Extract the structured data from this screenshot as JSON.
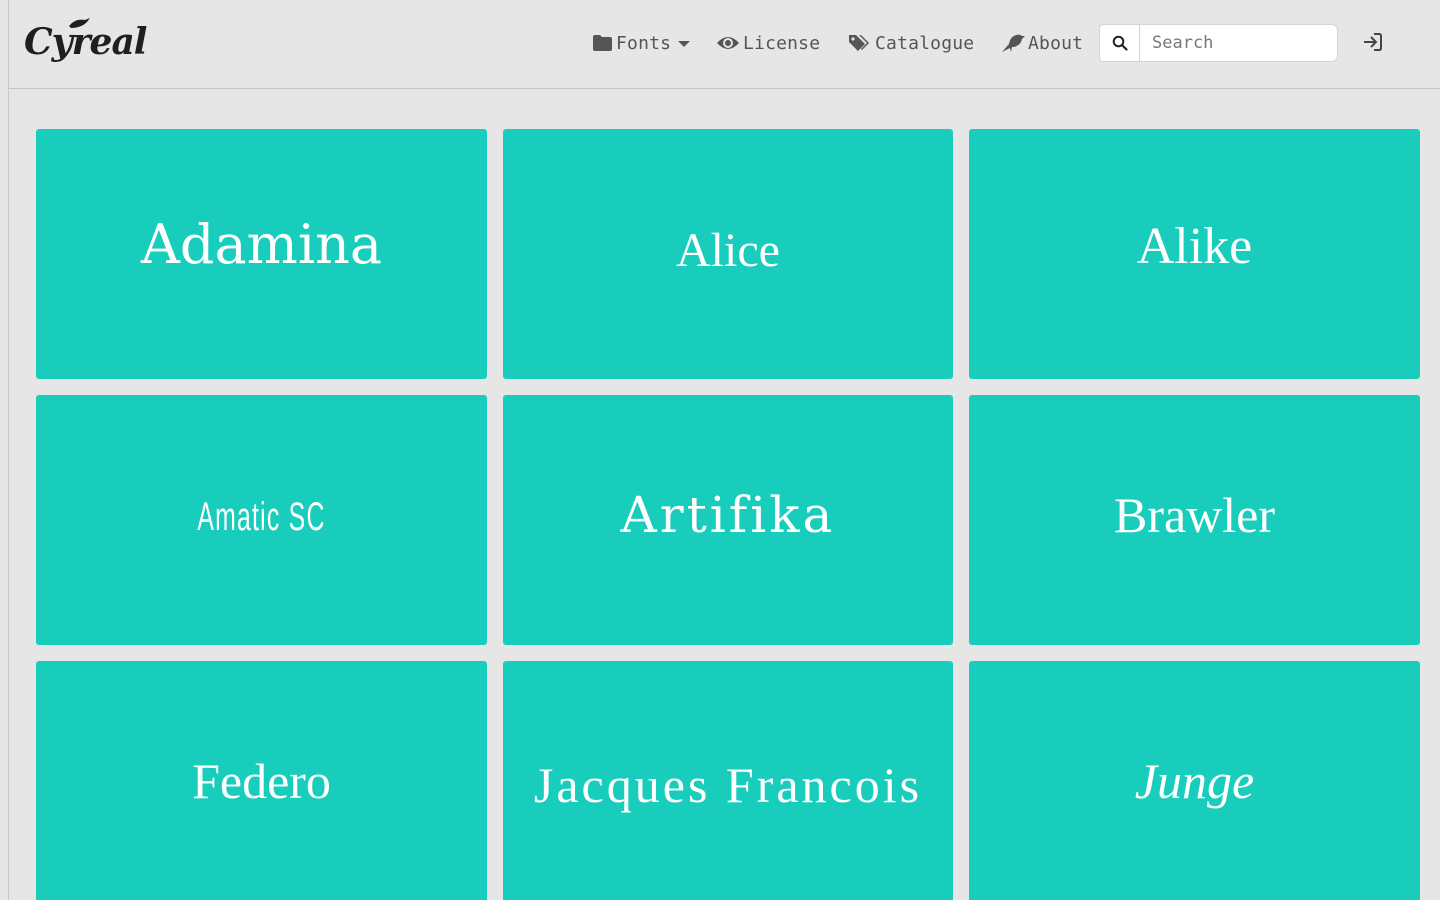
{
  "header": {
    "logo_text": "Cyreal",
    "nav": [
      {
        "label": "Fonts",
        "icon": "folder-icon",
        "has_dropdown": true
      },
      {
        "label": "License",
        "icon": "eye-icon"
      },
      {
        "label": "Catalogue",
        "icon": "tags-icon"
      },
      {
        "label": "About",
        "icon": "crow-icon"
      }
    ],
    "search": {
      "placeholder": "Search",
      "value": ""
    },
    "login_icon": "sign-in-icon"
  },
  "fonts": [
    {
      "name": "Adamina"
    },
    {
      "name": "Alice"
    },
    {
      "name": "Alike"
    },
    {
      "name": "Amatic SC"
    },
    {
      "name": "Artifika"
    },
    {
      "name": "Brawler"
    },
    {
      "name": "Federo"
    },
    {
      "name": "Jacques Francois"
    },
    {
      "name": "Junge"
    }
  ],
  "colors": {
    "card_background": "#19cdbd",
    "page_background": "#e6e6e6",
    "card_text": "#ffffff"
  }
}
